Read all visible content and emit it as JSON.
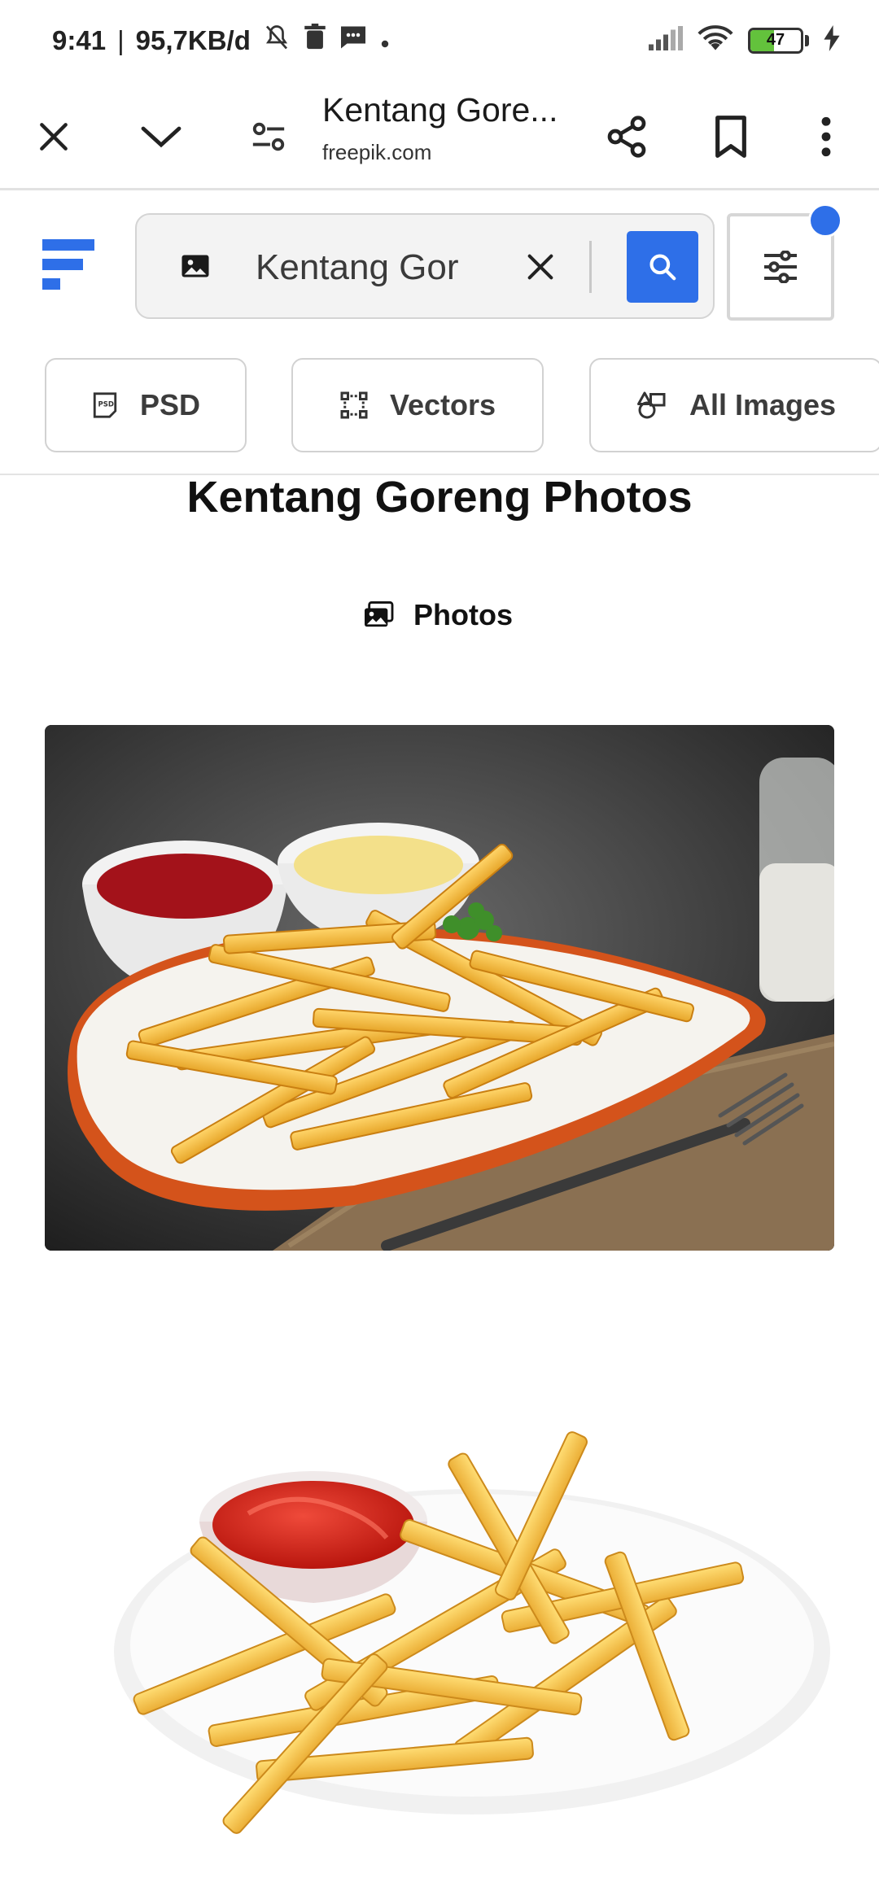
{
  "status_bar": {
    "time": "9:41",
    "separator": "|",
    "net_speed": "95,7KB/d",
    "battery_level": "47",
    "battery_fraction": 0.47
  },
  "browser": {
    "page_title": "Kentang Gore...",
    "domain": "freepik.com",
    "icons": [
      "close-icon",
      "chevron-down-icon",
      "site-settings-icon",
      "share-icon",
      "bookmark-icon",
      "more-vert-icon"
    ]
  },
  "site": {
    "search_value": "Kentang Gor",
    "chips": [
      {
        "label": "PSD",
        "icon": "psd-icon"
      },
      {
        "label": "Vectors",
        "icon": "vector-icon"
      },
      {
        "label": "All Images",
        "icon": "all-images-icon"
      }
    ],
    "accent_color": "#2e6fe8"
  },
  "content": {
    "heading": "Kentang Goreng Photos",
    "category_label": "Photos"
  }
}
